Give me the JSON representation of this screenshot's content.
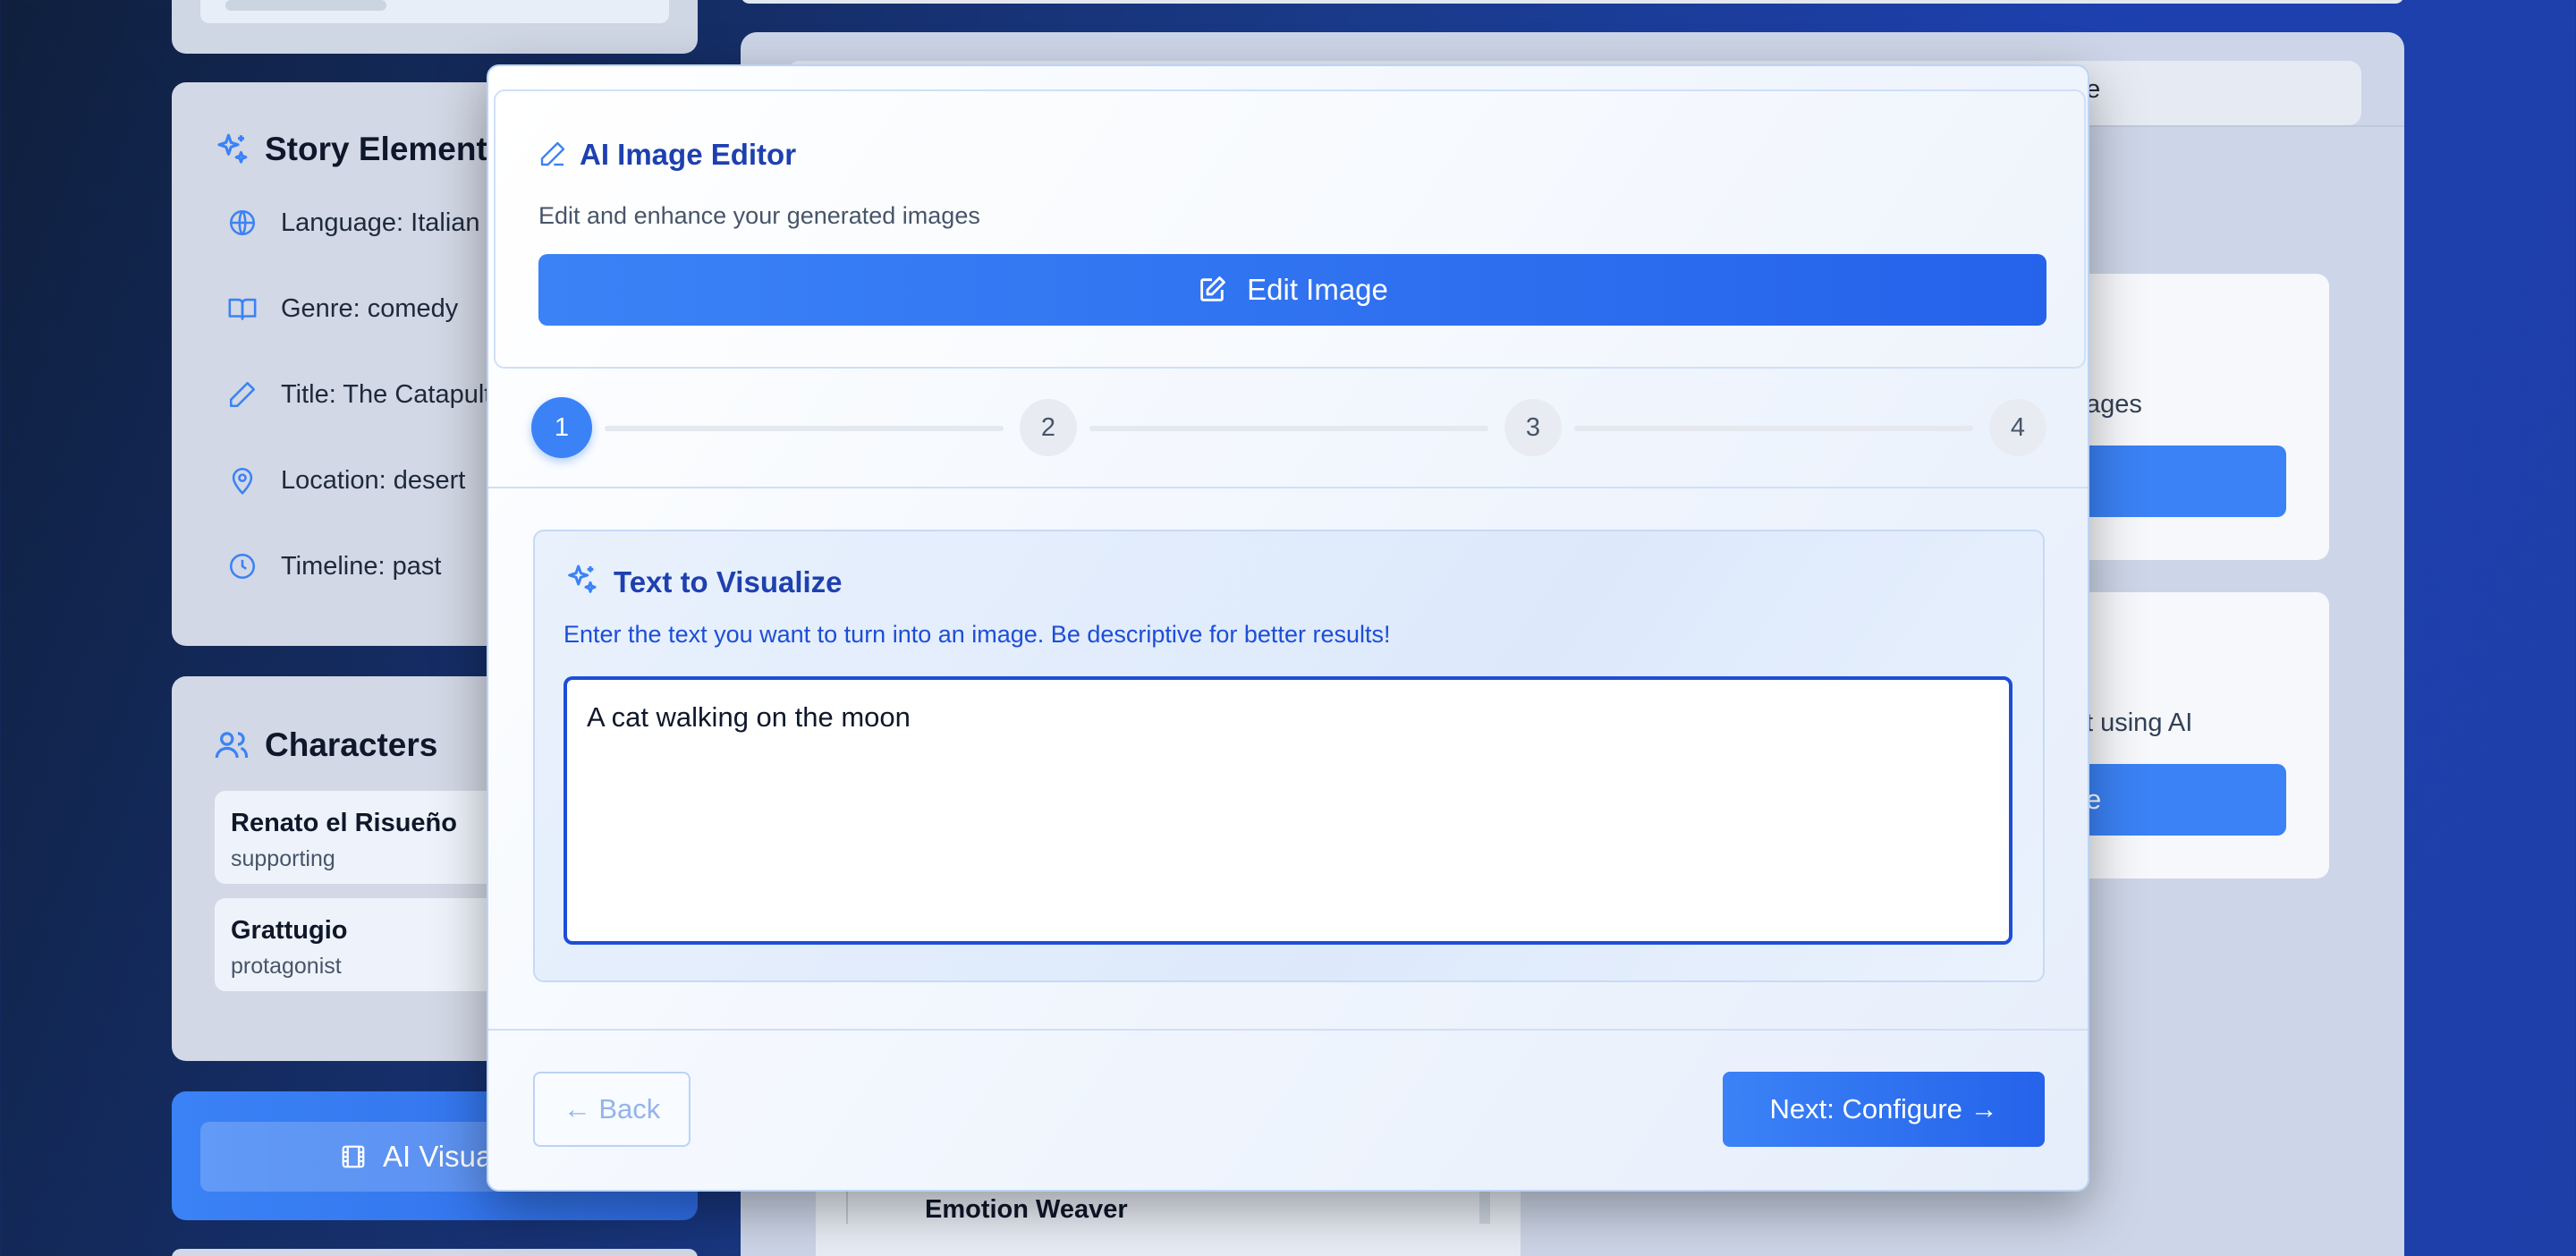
{
  "editor": {
    "title": "AI Image Editor",
    "subtitle": "Edit and enhance your generated images",
    "edit_button": "Edit Image"
  },
  "stepper": {
    "steps": [
      "1",
      "2",
      "3",
      "4"
    ],
    "current_step": 1
  },
  "visualize": {
    "title": "Text to Visualize",
    "help": "Enter the text you want to turn into an image. Be descriptive for better results!",
    "text": "A cat walking on the moon"
  },
  "footer": {
    "back_label": "← Back",
    "next_label": "Next: Configure →"
  },
  "sidebar": {
    "story_elements": {
      "title": "Story Elements",
      "items": [
        {
          "icon": "globe-icon",
          "label": "Language: Italian"
        },
        {
          "icon": "book-open-icon",
          "label": "Genre: comedy"
        },
        {
          "icon": "pencil-icon",
          "label": "Title: The Catapult"
        },
        {
          "icon": "map-pin-icon",
          "label": "Location: desert"
        },
        {
          "icon": "clock-icon",
          "label": "Timeline: past"
        }
      ]
    },
    "characters": {
      "title": "Characters",
      "items": [
        {
          "name": "Renato el Risueño",
          "role": "supporting"
        },
        {
          "name": "Grattugio",
          "role": "protagonist"
        }
      ]
    },
    "visual_button": "AI Visual S"
  },
  "background": {
    "tab_tail": "ne",
    "card1_text": "ages",
    "card2_text": "t using AI",
    "card2_button": "e",
    "emotion_label": "Emotion Weaver"
  },
  "colors": {
    "primary": "#3b82f6",
    "primary_dark": "#1e40af",
    "textarea_border": "#1d4ed8"
  }
}
